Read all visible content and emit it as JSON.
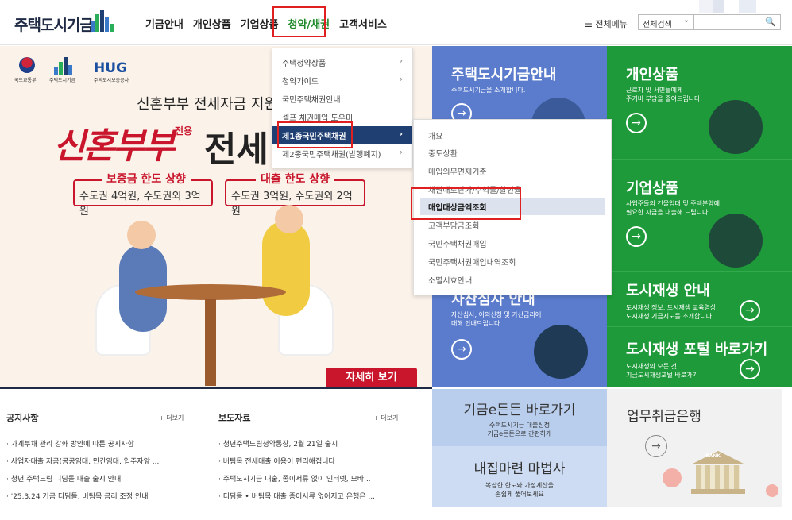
{
  "header": {
    "logo_text": "주택도시기금",
    "nav": [
      "기금안내",
      "개인상품",
      "기업상품",
      "청약/채권",
      "고객서비스"
    ],
    "all_menu": "전체메뉴",
    "search_select": "전체검색"
  },
  "banner": {
    "org1": "국토교통부",
    "org2": "주택도시기금",
    "org3_brand": "HUG",
    "org3": "주택도시보증공사",
    "subtitle": "신혼부부 전세자금 지원",
    "title_red": "신혼부부",
    "title_small": "전용",
    "title_black": "전세",
    "tag1_title": "보증금 한도 상향",
    "tag1_text": "수도권 4억원, 수도권외 3억원",
    "tag2_title": "대출 한도 상향",
    "tag2_text": "수도권 3억원, 수도권외 2억원",
    "more_button": "자세히 보기"
  },
  "menu1": {
    "items": [
      {
        "label": "주택청약상품",
        "chevron": true
      },
      {
        "label": "청약가이드",
        "chevron": true
      },
      {
        "label": "국민주택채권안내",
        "chevron": false
      },
      {
        "label": "셀프 채권매입 도우미",
        "chevron": false
      },
      {
        "label": "제1종국민주택채권",
        "chevron": true
      },
      {
        "label": "제2종국민주택채권(발행폐지)",
        "chevron": true
      }
    ]
  },
  "menu2": {
    "items": [
      "개요",
      "중도상환",
      "매입의무면제기준",
      "채권매도단가/수익률/할인율",
      "매입대상금액조회",
      "고객부담금조회",
      "국민주택채권매입",
      "국민주택채권매입내역조회",
      "소멸시효안내"
    ]
  },
  "tiles": {
    "fund": {
      "title": "주택도시기금안내",
      "desc": "주택도시기금을 소개합니다."
    },
    "personal": {
      "title": "개인상품",
      "desc1": "근로자 및 서민들에게",
      "desc2": "주거비 부담을 줄여드립니다."
    },
    "corporate": {
      "title": "기업상품",
      "desc1": "사업주들의 건물임대 및 주택분양에",
      "desc2": "필요한 자금을 대출해 드립니다."
    },
    "regen": {
      "title": "도시재생 안내",
      "desc1": "도시재생 정보, 도시재생 교육영상,",
      "desc2": "도시재생 기금지도를 소개합니다."
    },
    "portal": {
      "title": "도시재생 포털 바로가기",
      "desc1": "도시재생의 모든 것",
      "desc2": "기금도시재생포털 바로가기"
    },
    "asset": {
      "title": "자산심사 안내",
      "desc1": "자산심사, 이의신청 및 가산금리에",
      "desc2": "대해 안내드립니다."
    }
  },
  "notice": {
    "title": "공지사항",
    "more": "+ 더보기",
    "items": [
      "가계부채 관리 강화 방안에 따른 공지사항",
      "사업자대출 자금(공공임대, 민간임대, 입주자앞 ...",
      "청년 주택드림 디딤돌 대출 출시 안내",
      "'25.3.24 기금 디딤돌, 버팀목 금리 조정 안내"
    ]
  },
  "press": {
    "title": "보도자료",
    "more": "+ 더보기",
    "items": [
      "청년주택드림청약통장, 2월 21일 출시",
      "버팀목 전세대출 이용이 편리해집니다",
      "주택도시기금 대출, 종이서류 없이 인터넷, 모바...",
      "디딤돌 • 버팀목 대출 종이서류 없어지고 은행은 ..."
    ]
  },
  "bottom_tiles": {
    "efund": {
      "title": "기금e든든 바로가기",
      "desc1": "주택도시기금 대출신청",
      "desc2": "기금e든든으로 간편하게"
    },
    "myhome": {
      "title": "내집마련 마법사",
      "desc1": "복잡한 한도와 가정계산을",
      "desc2": "손쉽게 풀어보세요"
    },
    "bank": {
      "title": "업무취급은행",
      "sign": "BANK"
    }
  },
  "colors": {
    "blue": "#5b7ccc",
    "green": "#1f9a3a",
    "red": "#c9162c",
    "navy": "#1f3f73"
  }
}
